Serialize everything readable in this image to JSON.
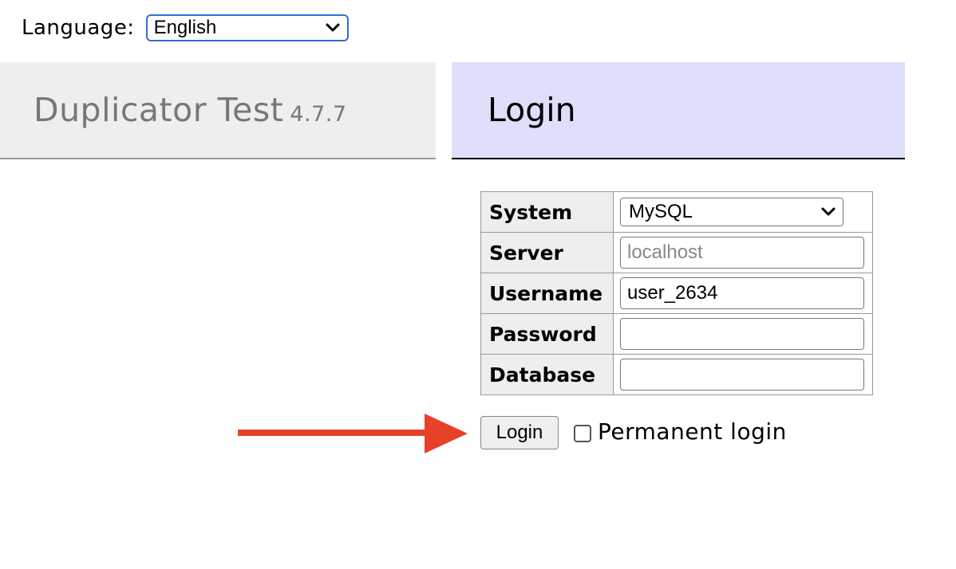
{
  "language": {
    "label": "Language:",
    "selected": "English"
  },
  "header": {
    "app_name": "Duplicator Test",
    "version": "4.7.7",
    "page_title": "Login"
  },
  "form": {
    "system": {
      "label": "System",
      "selected": "MySQL"
    },
    "server": {
      "label": "Server",
      "placeholder": "localhost",
      "value": ""
    },
    "username": {
      "label": "Username",
      "value": "user_2634"
    },
    "password": {
      "label": "Password",
      "value": ""
    },
    "database": {
      "label": "Database",
      "value": ""
    },
    "submit_label": "Login",
    "permanent_login_label": "Permanent login",
    "permanent_login_checked": false
  },
  "annotation": {
    "arrow_color": "#e8412a",
    "arrow_icon": "arrow-right-icon"
  },
  "colors": {
    "left_panel_bg": "#eeeeee",
    "right_panel_bg": "#dddffb",
    "focus_border": "#2f6fd6"
  }
}
